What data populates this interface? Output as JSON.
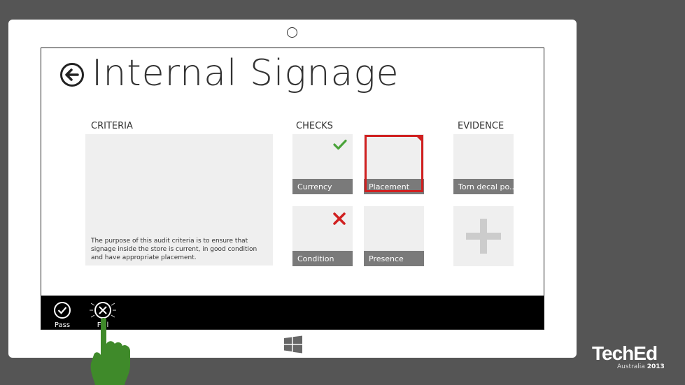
{
  "page": {
    "title": "Internal Signage"
  },
  "sections": {
    "criteria": "CRITERIA",
    "checks": "CHECKS",
    "evidence": "EVIDENCE"
  },
  "criteria": {
    "description": "The purpose of this audit criteria is to ensure that signage inside the store is current, in good condition and have appropriate placement."
  },
  "checks": [
    {
      "label": "Currency",
      "status": "pass"
    },
    {
      "label": "Placement",
      "status": "selected"
    },
    {
      "label": "Condition",
      "status": "fail"
    },
    {
      "label": "Presence",
      "status": "none"
    }
  ],
  "evidence": {
    "items": [
      {
        "label": "Torn decal po..."
      }
    ],
    "add_icon": "plus-icon"
  },
  "appbar": {
    "pass_label": "Pass",
    "fail_label": "Fail"
  },
  "branding": {
    "name": "TechEd",
    "region": "Australia",
    "year": "2013"
  },
  "colors": {
    "pass": "#4aa33a",
    "fail": "#d02020",
    "finger": "#3f8a2a",
    "tile": "#efefef",
    "tile_label": "#7a7a7a"
  }
}
